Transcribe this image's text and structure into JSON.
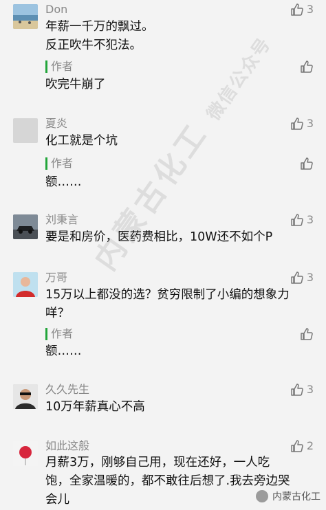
{
  "comments": [
    {
      "username": "Don",
      "likes": "3",
      "lines": [
        "年薪一千万的飘过。",
        "反正吹牛不犯法。"
      ],
      "reply": {
        "label": "作者",
        "text": "吹完牛崩了"
      }
    },
    {
      "username": "夏炎",
      "likes": "3",
      "lines": [
        "化工就是个坑"
      ],
      "reply": {
        "label": "作者",
        "text": "额……"
      }
    },
    {
      "username": "刘秉言",
      "likes": "3",
      "lines": [
        "要是和房价，医药费相比，10W还不如个P"
      ]
    },
    {
      "username": "万哥",
      "likes": "3",
      "lines": [
        "15万以上都没的选？贫穷限制了小编的想象力",
        "咩？"
      ],
      "reply": {
        "label": "作者",
        "text": "额……"
      }
    },
    {
      "username": "久久先生",
      "likes": "3",
      "lines": [
        "10万年薪真心不高"
      ]
    },
    {
      "username": "如此这般",
      "likes": "2",
      "lines": [
        "月薪3万，刚够自己用，现在还好，一人吃",
        "饱，全家温暖的，都不敢往后想了.我去旁边哭",
        "会儿"
      ]
    }
  ],
  "watermark": {
    "main": "内蒙古化工",
    "sub": "微信公众号"
  },
  "corner_logo": "内蒙古化工",
  "colors": {
    "accent_green": "#22a53a",
    "meta_gray": "#888888",
    "background": "#f3f3f3"
  }
}
